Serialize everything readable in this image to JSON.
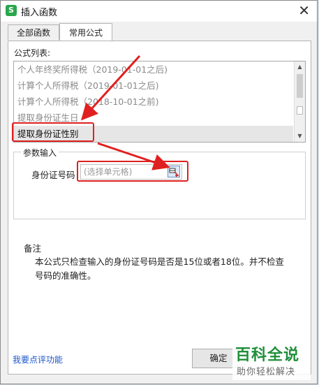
{
  "window": {
    "title": "插入函数",
    "app_icon_glyph": "S",
    "close_glyph": "✕"
  },
  "tabs": [
    {
      "label": "全部函数",
      "active": false
    },
    {
      "label": "常用公式",
      "active": true
    }
  ],
  "formula_list": {
    "label": "公式列表:",
    "items": [
      "个人年终奖所得税（2019-01-01之后)",
      "计算个人所得税（2019-01-01之后)",
      "计算个人所得税（2018-10-01之前)",
      "提取身份证生日",
      "提取身份证性别"
    ],
    "selected_index": 4
  },
  "params": {
    "group_title": "参数输入",
    "id_label": "身份证号码",
    "id_placeholder": "(选择单元格)",
    "picker_icon": "cell-picker-icon"
  },
  "notes": {
    "title": "备注",
    "body": "本公式只检查输入的身份证号码是否是15位或者18位。并不检查号码的准确性。"
  },
  "footer": {
    "feedback_link": "我要点评功能",
    "ok_label": "确定"
  },
  "watermark": {
    "main": "百科全说",
    "sub": "助你轻松解决"
  },
  "colors": {
    "annotation_red": "#e02020",
    "accent_link": "#1a55c9",
    "watermark_green": "#1f8f3a"
  }
}
